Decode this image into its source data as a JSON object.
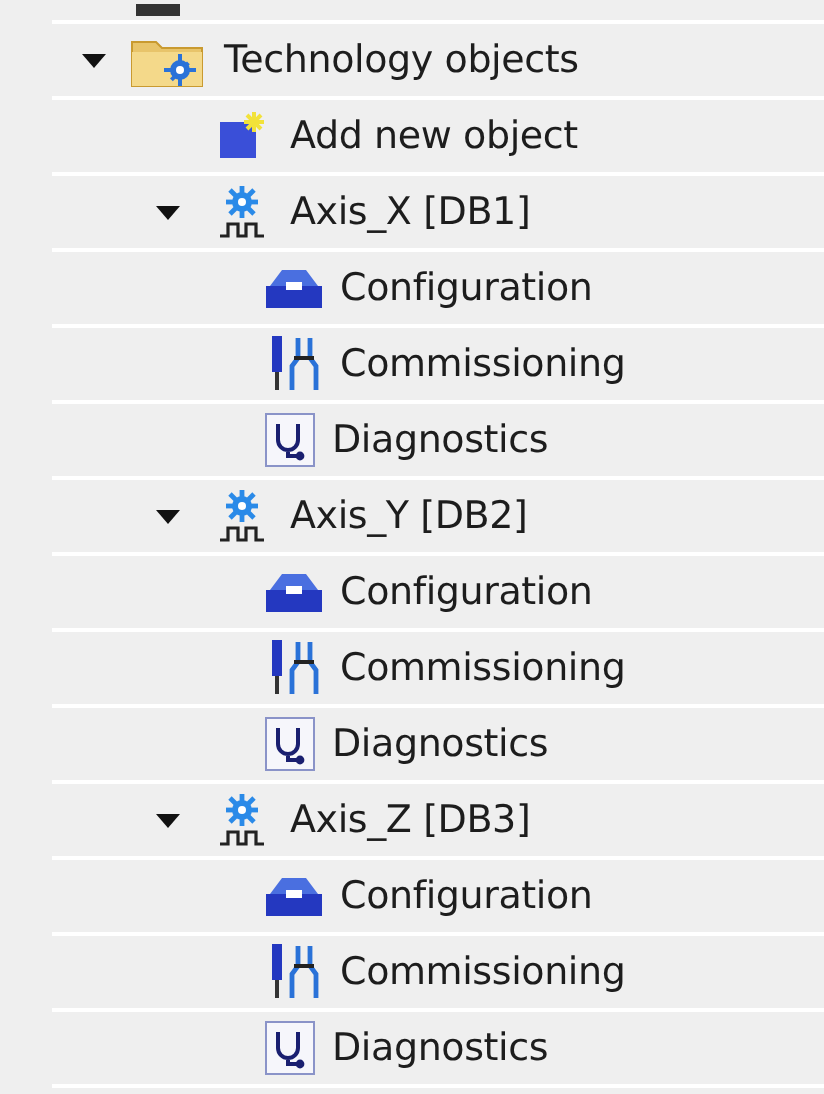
{
  "tree": [
    {
      "label": "Technology objects",
      "kind": "folder",
      "expanded": true,
      "children": [
        {
          "label": "Add new object",
          "kind": "add"
        },
        {
          "label": "Axis_X [DB1]",
          "kind": "axis",
          "expanded": true,
          "children": [
            {
              "label": "Configuration",
              "kind": "configuration"
            },
            {
              "label": "Commissioning",
              "kind": "commissioning"
            },
            {
              "label": "Diagnostics",
              "kind": "diagnostics"
            }
          ]
        },
        {
          "label": "Axis_Y [DB2]",
          "kind": "axis",
          "expanded": true,
          "children": [
            {
              "label": "Configuration",
              "kind": "configuration"
            },
            {
              "label": "Commissioning",
              "kind": "commissioning"
            },
            {
              "label": "Diagnostics",
              "kind": "diagnostics"
            }
          ]
        },
        {
          "label": "Axis_Z [DB3]",
          "kind": "axis",
          "expanded": true,
          "children": [
            {
              "label": "Configuration",
              "kind": "configuration"
            },
            {
              "label": "Commissioning",
              "kind": "commissioning"
            },
            {
              "label": "Diagnostics",
              "kind": "diagnostics"
            }
          ]
        }
      ]
    }
  ]
}
